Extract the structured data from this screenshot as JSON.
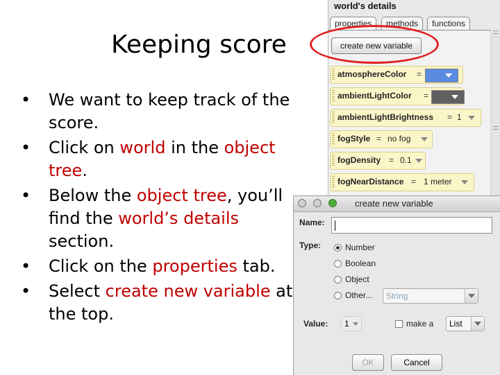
{
  "slide": {
    "title": "Keeping score",
    "bullets": [
      [
        {
          "t": "We want to keep track of the score."
        }
      ],
      [
        {
          "t": "Click on "
        },
        {
          "t": "world",
          "hl": true
        },
        {
          "t": " in the "
        },
        {
          "t": "object tree",
          "hl": true
        },
        {
          "t": "."
        }
      ],
      [
        {
          "t": "Below the "
        },
        {
          "t": "object tree",
          "hl": true
        },
        {
          "t": ", you’ll find the "
        },
        {
          "t": "world’s details",
          "hl": true
        },
        {
          "t": " section."
        }
      ],
      [
        {
          "t": "Click on the "
        },
        {
          "t": "properties",
          "hl": true
        },
        {
          "t": " tab."
        }
      ],
      [
        {
          "t": "Select "
        },
        {
          "t": "create new variable",
          "hl": true
        },
        {
          "t": " at the top."
        }
      ]
    ],
    "bullet_char": "•",
    "highlight_color": "#c00000"
  },
  "details": {
    "title": "world's details",
    "tabs": [
      "properties",
      "methods",
      "functions"
    ],
    "active_tab": "properties",
    "create_button": "create new variable",
    "properties": [
      {
        "name": "atmosphereColor",
        "eq": "=",
        "kind": "color",
        "color": "#5b8be0"
      },
      {
        "name": "ambientLightColor",
        "eq": "=",
        "kind": "color",
        "color": "#606060"
      },
      {
        "name": "ambientLightBrightness",
        "eq": "=",
        "value": "1"
      },
      {
        "name": "fogStyle",
        "eq": "=",
        "value": "no fog"
      },
      {
        "name": "fogDensity",
        "eq": "=",
        "value": "0.1"
      },
      {
        "name": "fogNearDistance",
        "eq": "=",
        "value": "1 meter"
      }
    ]
  },
  "dialog": {
    "title": "create new variable",
    "name_label": "Name:",
    "name_value": "",
    "type_label": "Type:",
    "types": [
      "Number",
      "Boolean",
      "Object",
      "Other..."
    ],
    "selected_type": "Number",
    "other_type": "String",
    "value_label": "Value:",
    "value": "1",
    "make_list_label": "make a",
    "list_type": "List",
    "ok": "OK",
    "cancel": "Cancel"
  },
  "annotation": {
    "color": "#e02020",
    "target": "create new variable"
  }
}
